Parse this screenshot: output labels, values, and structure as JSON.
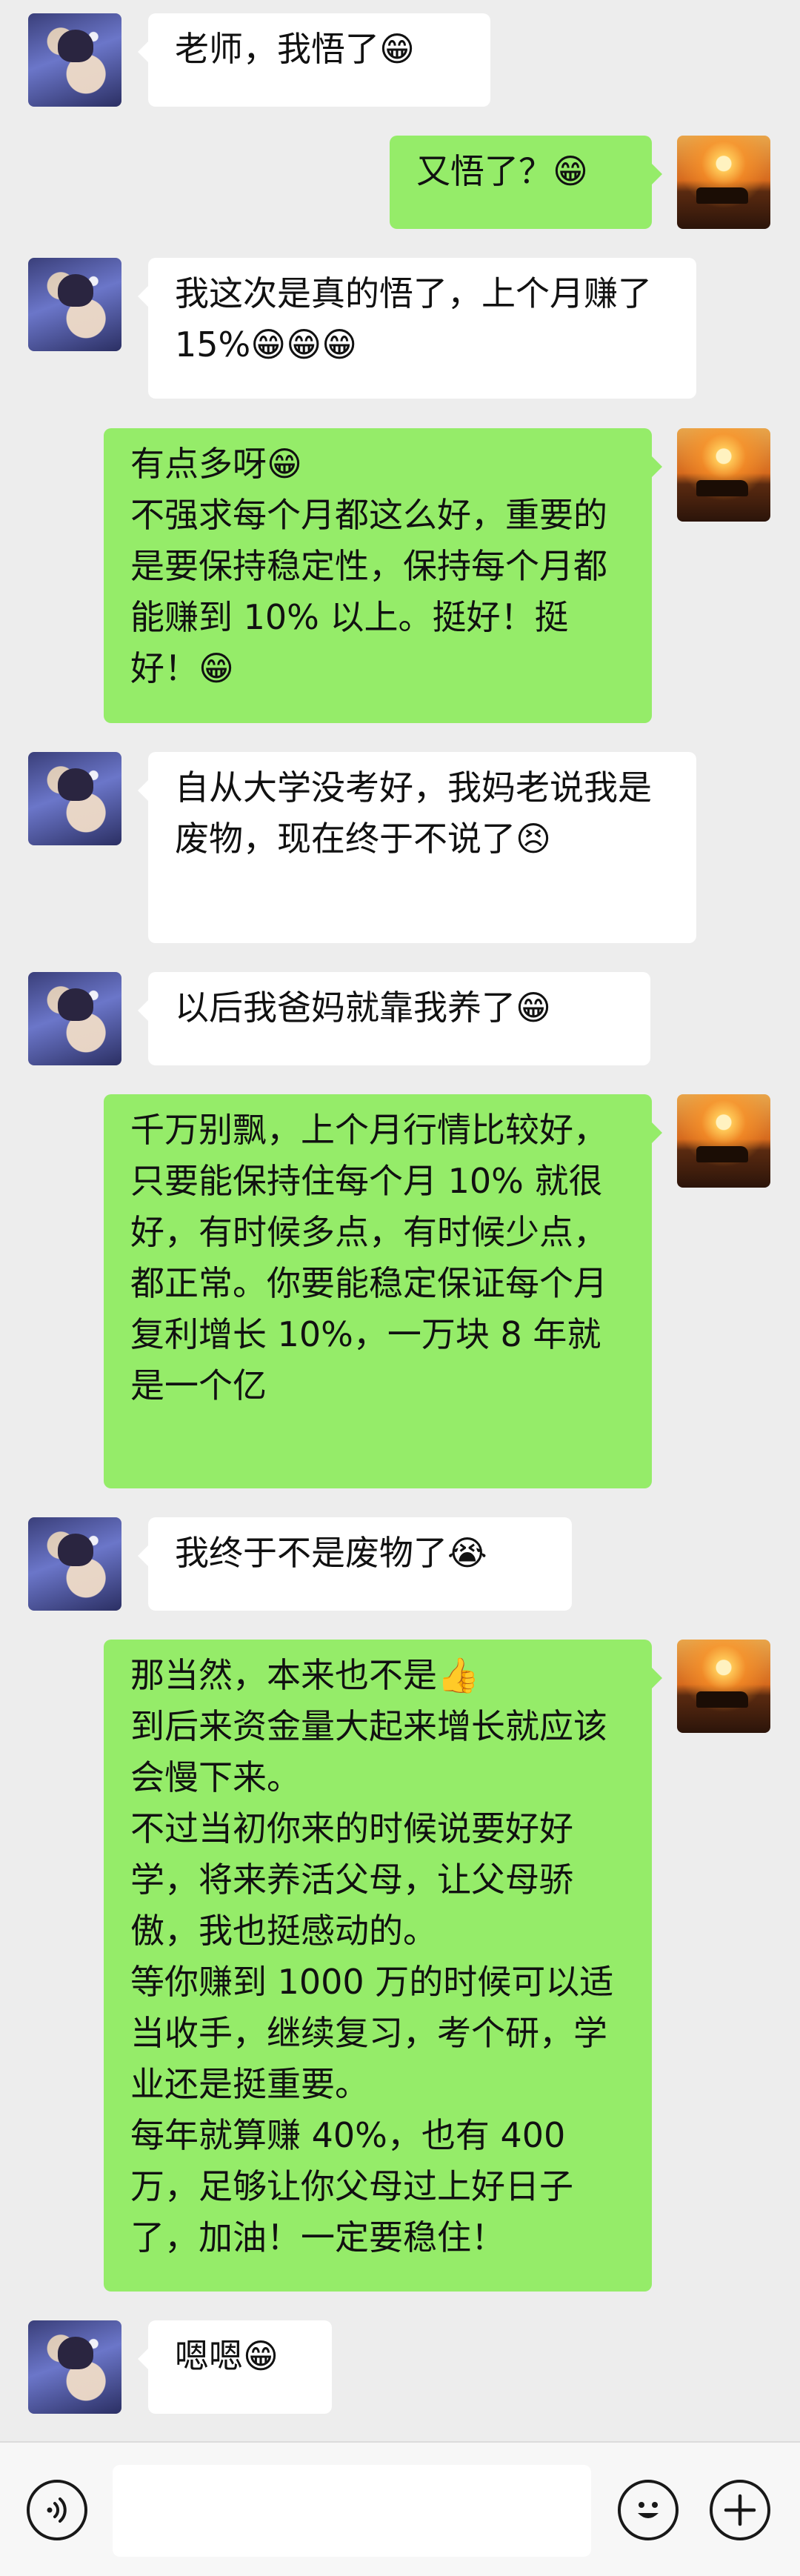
{
  "messages": [
    {
      "side": "in",
      "text": "老师，我悟了😁"
    },
    {
      "side": "out",
      "text": "又悟了？😁"
    },
    {
      "side": "in",
      "text": "我这次是真的悟了，上个月赚了 15%😁😁😁"
    },
    {
      "side": "out",
      "text": "有点多呀😁\n不强求每个月都这么好，重要的是要保持稳定性，保持每个月都能赚到 10% 以上。挺好！挺好！😁"
    },
    {
      "side": "in",
      "text": "自从大学没考好，我妈老说我是废物，现在终于不说了😣"
    },
    {
      "side": "in",
      "text": "以后我爸妈就靠我养了😁"
    },
    {
      "side": "out",
      "text": "千万别飘，上个月行情比较好，只要能保持住每个月 10% 就很好，有时候多点，有时候少点，都正常。你要能稳定保证每个月复利增长 10%，一万块 8 年就是一个亿"
    },
    {
      "side": "in",
      "text": "我终于不是废物了😭"
    },
    {
      "side": "out",
      "text": "那当然，本来也不是👍\n到后来资金量大起来增长就应该会慢下来。\n不过当初你来的时候说要好好学，将来养活父母，让父母骄傲，我也挺感动的。\n等你赚到 1000 万的时候可以适当收手，继续复习，考个研，学业还是挺重要。\n每年就算赚 40%，也有 400 万，足够让你父母过上好日子了，加油！一定要稳住！"
    },
    {
      "side": "in",
      "text": "嗯嗯😁"
    }
  ],
  "input_bar": {
    "voice_icon": "voice-icon",
    "placeholder": "",
    "emoji_icon": "emoji-icon",
    "plus_icon": "plus-icon"
  },
  "colors": {
    "background": "#ededed",
    "incoming_bubble": "#ffffff",
    "outgoing_bubble": "#95ec69"
  }
}
